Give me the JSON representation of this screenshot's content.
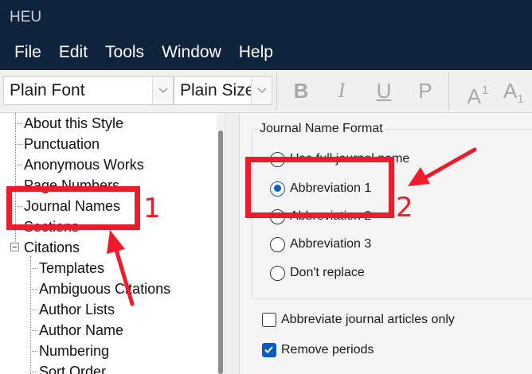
{
  "app": {
    "title": "HEU"
  },
  "menu": [
    "File",
    "Edit",
    "Tools",
    "Window",
    "Help"
  ],
  "toolbar": {
    "font_value": "Plain Font",
    "size_value": "Plain Size",
    "bold": "B",
    "italic": "I",
    "underline": "U",
    "plain": "P",
    "superscript_base": "A",
    "superscript_mark": "1",
    "subscript_base": "A",
    "subscript_mark": "1"
  },
  "tree": {
    "items": [
      "About this Style",
      "Punctuation",
      "Anonymous Works",
      "Page Numbers",
      "Journal Names",
      "Sections",
      "Citations",
      "Templates",
      "Ambiguous Citations",
      "Author Lists",
      "Author Name",
      "Numbering",
      "Sort Order"
    ]
  },
  "journal_format": {
    "group_title": "Journal Name Format",
    "options": [
      "Use full journal name",
      "Abbreviation 1",
      "Abbreviation 2",
      "Abbreviation 3",
      "Don't replace"
    ],
    "selected": "Abbreviation 1"
  },
  "checkboxes": [
    {
      "label": "Abbreviate journal articles only",
      "checked": false
    },
    {
      "label": "Remove periods",
      "checked": true
    }
  ],
  "annotations": {
    "label_1": "1",
    "label_2": "2",
    "color": "#ee1c2a"
  },
  "colors": {
    "titlebar": "#10233d",
    "accent": "#0a5bc4"
  }
}
